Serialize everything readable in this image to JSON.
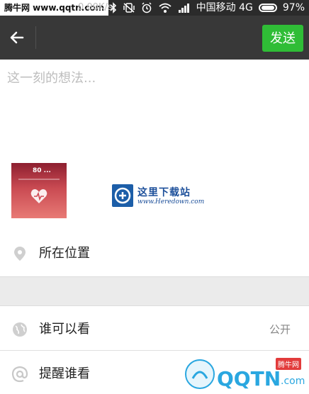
{
  "status_bar": {
    "watermark": "腾牛网 www.qqtn.com",
    "network_speed": "0.00K/s",
    "carrier": "中国移动 4G",
    "battery_percent": "97%",
    "icons": [
      "bluetooth-icon",
      "vibrate-off-icon",
      "alarm-icon",
      "wifi-icon",
      "signal-icon",
      "battery-icon"
    ]
  },
  "header": {
    "back_icon": "arrow-left-icon",
    "send_label": "发送",
    "send_color": "#2fbd36"
  },
  "composer": {
    "placeholder": "这一刻的想法...",
    "value": ""
  },
  "attachment": {
    "photo_text": "80 ..."
  },
  "watermark_center": {
    "title": "这里下载站",
    "subtitle": "www.Heredown.com"
  },
  "rows": {
    "location": {
      "label": "所在位置",
      "icon": "location-pin-icon"
    },
    "visibility": {
      "label": "谁可以看",
      "value": "公开",
      "icon": "globe-icon"
    },
    "mention": {
      "label": "提醒谁看",
      "icon": "at-icon"
    }
  },
  "watermark_bottom": {
    "text": "QQTN",
    "suffix": ".com",
    "badge": "腾牛网"
  }
}
